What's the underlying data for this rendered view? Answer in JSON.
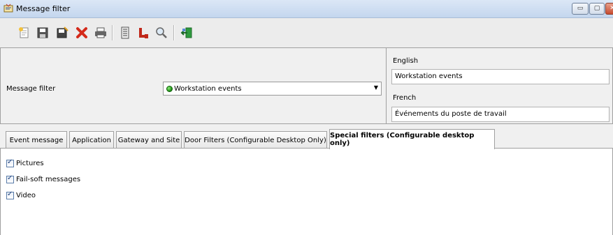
{
  "window": {
    "title": "Message filter"
  },
  "title_buttons": [
    {
      "name": "minimize-button",
      "icon": "minimize-icon",
      "glyph": "▭"
    },
    {
      "name": "maximize-button",
      "icon": "maximize-icon",
      "glyph": "▢"
    },
    {
      "name": "close-button",
      "icon": "close-icon",
      "glyph": "✕"
    }
  ],
  "toolbar": {
    "icons": [
      "new-icon",
      "save-icon",
      "save-as-icon",
      "delete-icon",
      "print-icon",
      "list-icon",
      "links-icon",
      "search-icon",
      "exit-icon"
    ]
  },
  "filter": {
    "label": "Message filter",
    "selected": "Workstation events"
  },
  "translations": {
    "english_label": "English",
    "english_value": "Workstation events",
    "french_label": "French",
    "french_value": "Événements du poste de travail"
  },
  "tabs": [
    {
      "label": "Event message"
    },
    {
      "label": "Application"
    },
    {
      "label": "Gateway and Site"
    },
    {
      "label": "Door Filters (Configurable Desktop Only)"
    },
    {
      "label": "Special filters (Configurable desktop only)",
      "active": true
    }
  ],
  "special_filters": [
    {
      "label": "Pictures",
      "checked": true
    },
    {
      "label": "Fail-soft messages",
      "checked": true
    },
    {
      "label": "Video",
      "checked": true
    }
  ],
  "colors": {
    "accent_green": "#1a8a12",
    "close_red": "#c74b2f"
  }
}
